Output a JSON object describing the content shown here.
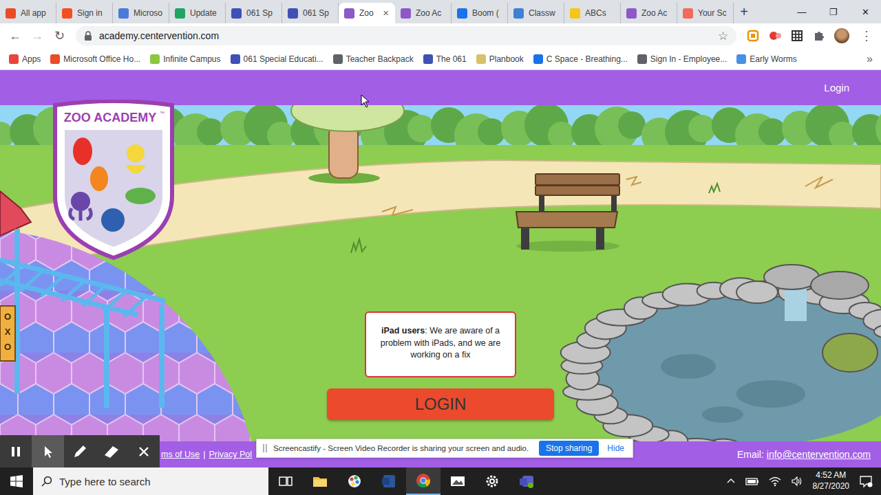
{
  "browser": {
    "tabs": [
      {
        "label": "All app",
        "color": "#e94c26",
        "selected": false
      },
      {
        "label": "Sign in",
        "color": "#f25022",
        "selected": false
      },
      {
        "label": "Microso",
        "color": "#4a7bd8",
        "selected": false
      },
      {
        "label": "Update",
        "color": "#1fa463",
        "selected": false
      },
      {
        "label": "061 Sp",
        "color": "#3f51b5",
        "selected": false
      },
      {
        "label": "061 Sp",
        "color": "#3f51b5",
        "selected": false
      },
      {
        "label": "Zoo",
        "color": "#8e58c8",
        "selected": true
      },
      {
        "label": "Zoo Ac",
        "color": "#8e58c8",
        "selected": false
      },
      {
        "label": "Boom (",
        "color": "#1a73e8",
        "selected": false
      },
      {
        "label": "Classw",
        "color": "#3f7fd6",
        "selected": false
      },
      {
        "label": "ABCs",
        "color": "#f5c518",
        "selected": false
      },
      {
        "label": "Zoo Ac",
        "color": "#8e58c8",
        "selected": false
      },
      {
        "label": "Your Sc",
        "color": "#f06b5b",
        "selected": false
      }
    ],
    "tab_close": "✕",
    "new_tab": "+",
    "window_controls": [
      "—",
      "❐",
      "✕"
    ],
    "nav": [
      {
        "glyph": "←",
        "disabled": false
      },
      {
        "glyph": "→",
        "disabled": true
      },
      {
        "glyph": "↻",
        "disabled": false
      }
    ],
    "url": "academy.centervention.com",
    "star": "☆",
    "menu": "⋮",
    "bookmarks": [
      {
        "label": "Apps",
        "color": "#e8453c"
      },
      {
        "label": "Microsoft Office Ho...",
        "color": "#e94c26"
      },
      {
        "label": "Infinite Campus",
        "color": "#8dc63f"
      },
      {
        "label": "061 Special Educati...",
        "color": "#3f51b5"
      },
      {
        "label": "Teacher Backpack",
        "color": "#5f6368"
      },
      {
        "label": "The 061",
        "color": "#3f51b5"
      },
      {
        "label": "Planbook",
        "color": "#d9c06a"
      },
      {
        "label": "C Space - Breathing...",
        "color": "#1a73e8"
      },
      {
        "label": "Sign In - Employee...",
        "color": "#5f6368"
      },
      {
        "label": "Early Worms",
        "color": "#4a90e2"
      }
    ],
    "bookmarks_more": "»"
  },
  "page": {
    "header_login": "Login",
    "logo_title": "ZOO ACADEMY",
    "logo_tm": "™",
    "game_sign": [
      "O",
      "X",
      "O"
    ],
    "notice": {
      "bold": "iPad users",
      "text": ": We are aware of a problem with iPads, and we are working on a fix"
    },
    "login_button": "LOGIN",
    "footer": {
      "links": [
        "ms of Use",
        "Privacy Pol"
      ],
      "separator": "|",
      "email_label": "Email:",
      "email": "info@centervention.com"
    }
  },
  "recorder": {
    "tools": [
      {
        "kind": "pause",
        "selected": false
      },
      {
        "kind": "pointer",
        "selected": true
      },
      {
        "kind": "pen",
        "selected": false
      },
      {
        "kind": "eraser",
        "selected": false
      },
      {
        "kind": "close",
        "selected": false
      }
    ],
    "sharing": {
      "message": "Screencastify - Screen Video Recorder is sharing your screen and audio.",
      "stop": "Stop sharing",
      "hide": "Hide"
    }
  },
  "taskbar": {
    "search_placeholder": "Type here to search",
    "apps": [
      {
        "kind": "taskview",
        "active": false
      },
      {
        "kind": "explorer",
        "active": false
      },
      {
        "kind": "paint",
        "active": false
      },
      {
        "kind": "word",
        "active": false
      },
      {
        "kind": "chrome",
        "active": true
      },
      {
        "kind": "photos",
        "active": false
      },
      {
        "kind": "settings",
        "active": false
      },
      {
        "kind": "teams",
        "active": false
      }
    ],
    "time": "4:52 AM",
    "date": "8/27/2020"
  }
}
